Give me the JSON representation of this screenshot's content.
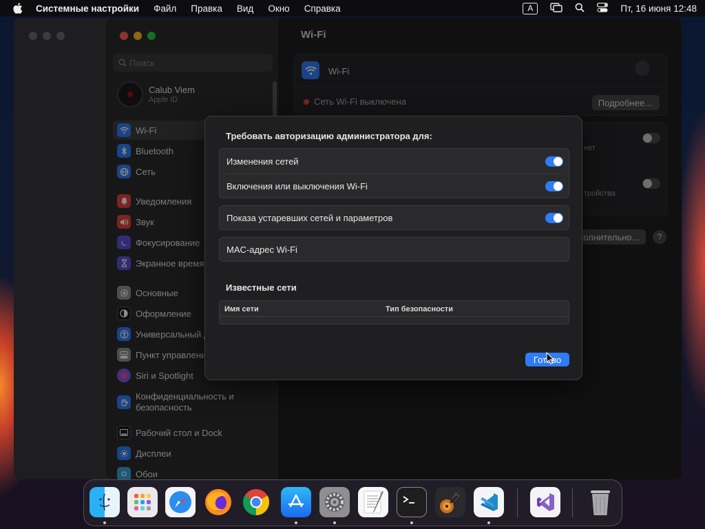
{
  "menubar": {
    "app_name": "Системные настройки",
    "items": [
      "Файл",
      "Правка",
      "Вид",
      "Окно",
      "Справка"
    ],
    "input_source": "A",
    "datetime": "Пт, 16 июня  12:48"
  },
  "sidebar": {
    "search_placeholder": "Поиск",
    "account_name": "Calub Viem",
    "account_sub": "Apple ID",
    "items": [
      {
        "label": "Wi-Fi",
        "icon": "wifi-icon",
        "color": "#2f7cf6"
      },
      {
        "label": "Bluetooth",
        "icon": "bluetooth-icon",
        "color": "#2f7cf6"
      },
      {
        "label": "Сеть",
        "icon": "globe-icon",
        "color": "#2f7cf6"
      },
      {
        "label": "Уведомления",
        "icon": "bell-icon",
        "color": "#e0443b"
      },
      {
        "label": "Звук",
        "icon": "speaker-icon",
        "color": "#e0443b"
      },
      {
        "label": "Фокусирование",
        "icon": "moon-icon",
        "color": "#5b4fd6"
      },
      {
        "label": "Экранное время",
        "icon": "hourglass-icon",
        "color": "#5b4fd6"
      },
      {
        "label": "Основные",
        "icon": "gear-icon",
        "color": "#8e8e93"
      },
      {
        "label": "Оформление",
        "icon": "appearance-icon",
        "color": "#1c1c1e"
      },
      {
        "label": "Универсальный доступ",
        "icon": "accessibility-icon",
        "color": "#2f7cf6"
      },
      {
        "label": "Пункт управления",
        "icon": "control-center-icon",
        "color": "#8e8e93"
      },
      {
        "label": "Siri и Spotlight",
        "icon": "siri-icon",
        "color": "#b04fd6"
      },
      {
        "label": "Конфиденциальность и безопасность",
        "icon": "hand-icon",
        "color": "#2f7cf6"
      },
      {
        "label": "Рабочий стол и Dock",
        "icon": "dock-icon",
        "color": "#1c1c1e"
      },
      {
        "label": "Дисплеи",
        "icon": "sun-icon",
        "color": "#2f7cf6"
      },
      {
        "label": "Обои",
        "icon": "wallpaper-icon",
        "color": "#3aa0d6"
      }
    ]
  },
  "content": {
    "title": "Wi-Fi",
    "wifi_label": "Wi-Fi",
    "status": "Сеть Wi-Fi выключена",
    "details_button": "Подробнее…",
    "partial_text_1": "нет",
    "partial_text_2": "тройства",
    "advanced_button": "олнительно…",
    "help": "?"
  },
  "sheet": {
    "heading": "Требовать авторизацию администратора для:",
    "rows": [
      {
        "label": "Изменения сетей",
        "on": true
      },
      {
        "label": "Включения или выключения Wi-Fi",
        "on": true
      },
      {
        "label": "Показа устаревших сетей и параметров",
        "on": true
      },
      {
        "label": "MAC-адрес Wi-Fi"
      }
    ],
    "known_networks_title": "Известные сети",
    "table_headers": [
      "Имя сети",
      "Тип безопасности"
    ],
    "done_button": "Готово"
  },
  "dock": {
    "apps": [
      "Finder",
      "Launchpad",
      "Safari",
      "Firefox",
      "Chrome",
      "App Store",
      "Системные настройки",
      "TextEdit",
      "Terminal",
      "GarageBand",
      "Visual Studio Code",
      "Visual Studio",
      "Корзина"
    ]
  }
}
